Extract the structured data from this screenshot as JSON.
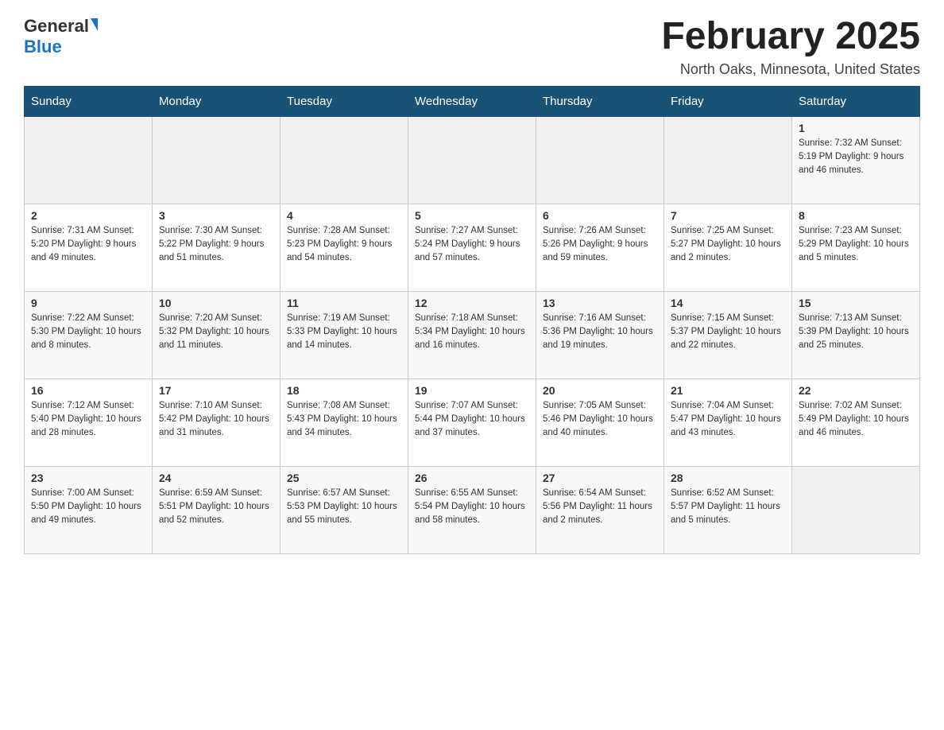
{
  "header": {
    "logo_general": "General",
    "logo_blue": "Blue",
    "month_title": "February 2025",
    "location": "North Oaks, Minnesota, United States"
  },
  "days_of_week": [
    "Sunday",
    "Monday",
    "Tuesday",
    "Wednesday",
    "Thursday",
    "Friday",
    "Saturday"
  ],
  "weeks": [
    {
      "cells": [
        {
          "day": "",
          "info": ""
        },
        {
          "day": "",
          "info": ""
        },
        {
          "day": "",
          "info": ""
        },
        {
          "day": "",
          "info": ""
        },
        {
          "day": "",
          "info": ""
        },
        {
          "day": "",
          "info": ""
        },
        {
          "day": "1",
          "info": "Sunrise: 7:32 AM\nSunset: 5:19 PM\nDaylight: 9 hours and 46 minutes."
        }
      ]
    },
    {
      "cells": [
        {
          "day": "2",
          "info": "Sunrise: 7:31 AM\nSunset: 5:20 PM\nDaylight: 9 hours and 49 minutes."
        },
        {
          "day": "3",
          "info": "Sunrise: 7:30 AM\nSunset: 5:22 PM\nDaylight: 9 hours and 51 minutes."
        },
        {
          "day": "4",
          "info": "Sunrise: 7:28 AM\nSunset: 5:23 PM\nDaylight: 9 hours and 54 minutes."
        },
        {
          "day": "5",
          "info": "Sunrise: 7:27 AM\nSunset: 5:24 PM\nDaylight: 9 hours and 57 minutes."
        },
        {
          "day": "6",
          "info": "Sunrise: 7:26 AM\nSunset: 5:26 PM\nDaylight: 9 hours and 59 minutes."
        },
        {
          "day": "7",
          "info": "Sunrise: 7:25 AM\nSunset: 5:27 PM\nDaylight: 10 hours and 2 minutes."
        },
        {
          "day": "8",
          "info": "Sunrise: 7:23 AM\nSunset: 5:29 PM\nDaylight: 10 hours and 5 minutes."
        }
      ]
    },
    {
      "cells": [
        {
          "day": "9",
          "info": "Sunrise: 7:22 AM\nSunset: 5:30 PM\nDaylight: 10 hours and 8 minutes."
        },
        {
          "day": "10",
          "info": "Sunrise: 7:20 AM\nSunset: 5:32 PM\nDaylight: 10 hours and 11 minutes."
        },
        {
          "day": "11",
          "info": "Sunrise: 7:19 AM\nSunset: 5:33 PM\nDaylight: 10 hours and 14 minutes."
        },
        {
          "day": "12",
          "info": "Sunrise: 7:18 AM\nSunset: 5:34 PM\nDaylight: 10 hours and 16 minutes."
        },
        {
          "day": "13",
          "info": "Sunrise: 7:16 AM\nSunset: 5:36 PM\nDaylight: 10 hours and 19 minutes."
        },
        {
          "day": "14",
          "info": "Sunrise: 7:15 AM\nSunset: 5:37 PM\nDaylight: 10 hours and 22 minutes."
        },
        {
          "day": "15",
          "info": "Sunrise: 7:13 AM\nSunset: 5:39 PM\nDaylight: 10 hours and 25 minutes."
        }
      ]
    },
    {
      "cells": [
        {
          "day": "16",
          "info": "Sunrise: 7:12 AM\nSunset: 5:40 PM\nDaylight: 10 hours and 28 minutes."
        },
        {
          "day": "17",
          "info": "Sunrise: 7:10 AM\nSunset: 5:42 PM\nDaylight: 10 hours and 31 minutes."
        },
        {
          "day": "18",
          "info": "Sunrise: 7:08 AM\nSunset: 5:43 PM\nDaylight: 10 hours and 34 minutes."
        },
        {
          "day": "19",
          "info": "Sunrise: 7:07 AM\nSunset: 5:44 PM\nDaylight: 10 hours and 37 minutes."
        },
        {
          "day": "20",
          "info": "Sunrise: 7:05 AM\nSunset: 5:46 PM\nDaylight: 10 hours and 40 minutes."
        },
        {
          "day": "21",
          "info": "Sunrise: 7:04 AM\nSunset: 5:47 PM\nDaylight: 10 hours and 43 minutes."
        },
        {
          "day": "22",
          "info": "Sunrise: 7:02 AM\nSunset: 5:49 PM\nDaylight: 10 hours and 46 minutes."
        }
      ]
    },
    {
      "cells": [
        {
          "day": "23",
          "info": "Sunrise: 7:00 AM\nSunset: 5:50 PM\nDaylight: 10 hours and 49 minutes."
        },
        {
          "day": "24",
          "info": "Sunrise: 6:59 AM\nSunset: 5:51 PM\nDaylight: 10 hours and 52 minutes."
        },
        {
          "day": "25",
          "info": "Sunrise: 6:57 AM\nSunset: 5:53 PM\nDaylight: 10 hours and 55 minutes."
        },
        {
          "day": "26",
          "info": "Sunrise: 6:55 AM\nSunset: 5:54 PM\nDaylight: 10 hours and 58 minutes."
        },
        {
          "day": "27",
          "info": "Sunrise: 6:54 AM\nSunset: 5:56 PM\nDaylight: 11 hours and 2 minutes."
        },
        {
          "day": "28",
          "info": "Sunrise: 6:52 AM\nSunset: 5:57 PM\nDaylight: 11 hours and 5 minutes."
        },
        {
          "day": "",
          "info": ""
        }
      ]
    }
  ]
}
